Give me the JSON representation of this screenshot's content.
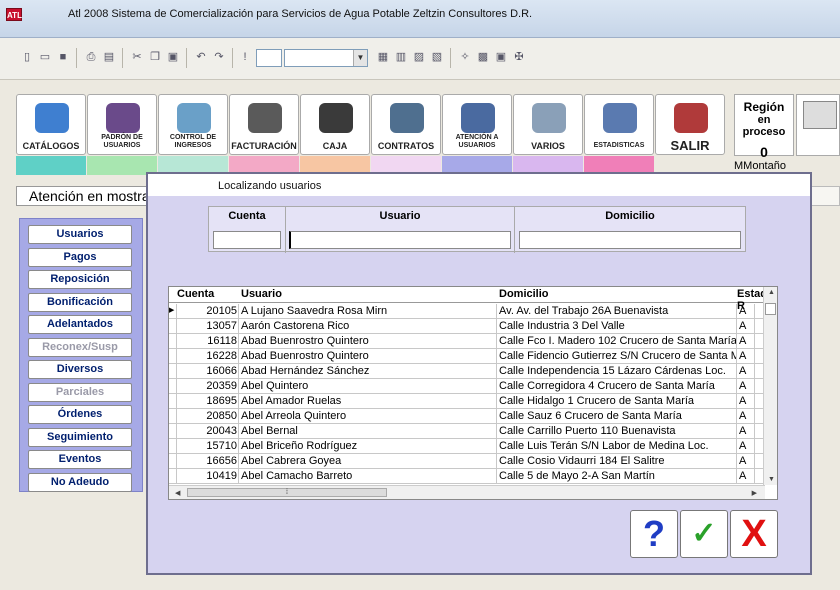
{
  "window": {
    "icon_text": "ATL",
    "title": "Atl 2008  Sistema de Comercialización para Servicios de Agua Potable    Zeltzin Consultores D.R."
  },
  "toolbar": {
    "icons": [
      "new-icon",
      "open-icon",
      "save-icon",
      "print-icon",
      "preview-icon",
      "cut-icon",
      "copy-icon",
      "paste-icon",
      "undo-icon",
      "redo-icon",
      "run-icon",
      "chart-icon",
      "view1-icon",
      "view2-icon",
      "view3-icon",
      "view4-icon",
      "tool1-icon",
      "tool2-icon",
      "tool3-icon",
      "tool4-icon"
    ]
  },
  "modules": [
    {
      "label": "CATÁLOGOS",
      "swatch": "#5fd0c6",
      "art": "#3f7fd0"
    },
    {
      "label": "PADRÓN DE USUARIOS",
      "swatch": "#a8e6b0",
      "art": "#6a4a8a"
    },
    {
      "label": "CONTROL DE INGRESOS",
      "swatch": "#b7e7d6",
      "art": "#6aa0c8"
    },
    {
      "label": "FACTURACIÓN",
      "swatch": "#f3a9c6",
      "art": "#5a5a5a"
    },
    {
      "label": "CAJA",
      "swatch": "#f7c6a3",
      "art": "#3a3a3a"
    },
    {
      "label": "CONTRATOS",
      "swatch": "#f1d7f2",
      "art": "#4f6f8f"
    },
    {
      "label": "ATENCIÓN A USUARIOS",
      "swatch": "#a7a9e8",
      "art": "#4a6aa0"
    },
    {
      "label": "VARIOS",
      "swatch": "#d9b7ef",
      "art": "#8aa0b8"
    },
    {
      "label": "ESTADISTICAS",
      "swatch": "#f07fb8",
      "art": "#5a7ab0"
    }
  ],
  "salir": {
    "label": "SALIR",
    "art": "#b03a3a"
  },
  "region": {
    "title": "Región",
    "subtitle": "en proceso",
    "value": "0"
  },
  "user": "MMontaño",
  "status": {
    "attention": "Atención en mostrador"
  },
  "sidebar": [
    {
      "label": "Usuarios",
      "enabled": true
    },
    {
      "label": "Pagos",
      "enabled": true
    },
    {
      "label": "Reposición",
      "enabled": true
    },
    {
      "label": "Bonificación",
      "enabled": true
    },
    {
      "label": "Adelantados",
      "enabled": true
    },
    {
      "label": "Reconex/Susp",
      "enabled": false
    },
    {
      "label": "Diversos",
      "enabled": true
    },
    {
      "label": "Parciales",
      "enabled": false
    },
    {
      "label": "Órdenes",
      "enabled": true
    },
    {
      "label": "Seguimiento",
      "enabled": true
    },
    {
      "label": "Eventos",
      "enabled": true
    },
    {
      "label": "No Adeudo",
      "enabled": true
    }
  ],
  "dialog": {
    "caption": "Localizando usuarios",
    "search": {
      "cuenta_label": "Cuenta",
      "usuario_label": "Usuario",
      "domicilio_label": "Domicilio",
      "cuenta_value": "",
      "usuario_value": "",
      "domicilio_value": ""
    },
    "grid": {
      "headers": {
        "cuenta": "Cuenta",
        "usuario": "Usuario",
        "domicilio": "Domicilio",
        "estado": "Estado R"
      },
      "rows": [
        {
          "cuenta": "20105",
          "usuario": "A Lujano Saavedra Rosa Mirn",
          "domicilio": "Av.  Av. del Trabajo  26A Buenavista",
          "estado": "A"
        },
        {
          "cuenta": "13057",
          "usuario": "Aarón Castorena Rico",
          "domicilio": "Calle Industria   3 Del Valle",
          "estado": "A"
        },
        {
          "cuenta": "16118",
          "usuario": "Abad Buenrostro Quintero",
          "domicilio": "Calle Fco I. Madero  102 Crucero de Santa María",
          "estado": "A"
        },
        {
          "cuenta": "16228",
          "usuario": "Abad Buenrostro Quintero",
          "domicilio": "Calle Fidencio Gutierrez  S/N Crucero de Santa Mar",
          "estado": "A"
        },
        {
          "cuenta": "16066",
          "usuario": "Abad Hernández Sánchez",
          "domicilio": "Calle Independencia  15 Lázaro Cárdenas Loc.",
          "estado": "A"
        },
        {
          "cuenta": "20359",
          "usuario": "Abel  Quintero",
          "domicilio": "Calle Corregidora   4 Crucero de Santa María",
          "estado": "A"
        },
        {
          "cuenta": "18695",
          "usuario": "Abel Amador Ruelas",
          "domicilio": "Calle Hidalgo   1 Crucero de Santa María",
          "estado": "A"
        },
        {
          "cuenta": "20850",
          "usuario": "Abel Arreola Quintero",
          "domicilio": "Calle Sauz   6 Crucero de Santa María",
          "estado": "A"
        },
        {
          "cuenta": "20043",
          "usuario": "Abel Bernal",
          "domicilio": "Calle Carrillo Puerto  110 Buenavista",
          "estado": "A"
        },
        {
          "cuenta": "15710",
          "usuario": "Abel Briceño Rodríguez",
          "domicilio": "Calle Luis Terán  S/N Labor de Medina Loc.",
          "estado": "A"
        },
        {
          "cuenta": "16656",
          "usuario": "Abel Cabrera Goyea",
          "domicilio": "Calle Cosio Vidaurri  184 El Salitre",
          "estado": "A"
        },
        {
          "cuenta": "10419",
          "usuario": "Abel Camacho Barreto",
          "domicilio": "Calle 5 de Mayo  2-A San Martín",
          "estado": "A"
        }
      ]
    },
    "buttons": {
      "help": "?",
      "ok": "✓",
      "cancel": "X"
    }
  }
}
